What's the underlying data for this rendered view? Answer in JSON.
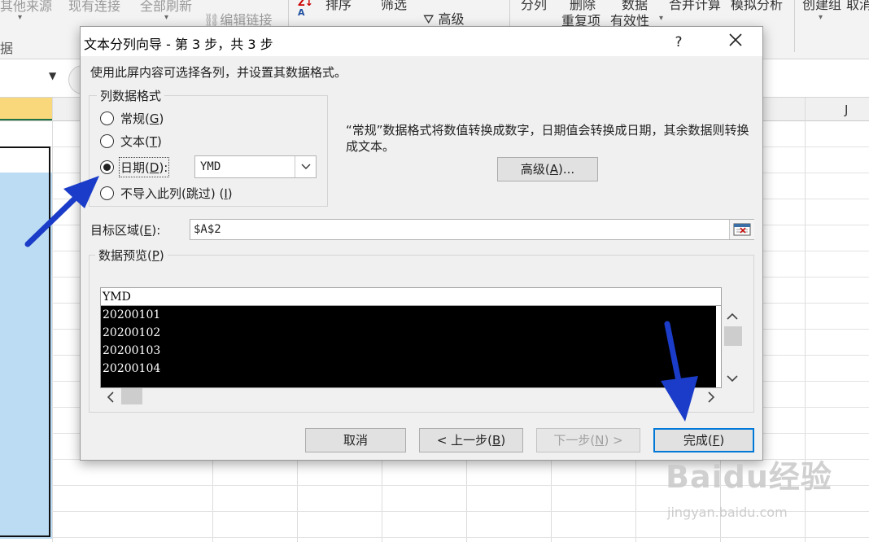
{
  "ribbon": {
    "items": [
      {
        "label": "其他来源"
      },
      {
        "label": "现有连接"
      },
      {
        "label": "全部刷新"
      },
      {
        "label": "编辑链接"
      },
      {
        "label": "排序"
      },
      {
        "label": "筛选"
      },
      {
        "label": "高级"
      },
      {
        "label": "分列"
      },
      {
        "label": "删除"
      },
      {
        "label": "数据"
      },
      {
        "label": "合并计算"
      },
      {
        "label": "模拟分析"
      },
      {
        "label": "创建组"
      },
      {
        "label": "取消"
      },
      {
        "label": "重复项"
      },
      {
        "label": "有效性"
      }
    ],
    "group_label": "据"
  },
  "sheet": {
    "column_j": "J",
    "accent_color": "#217346",
    "selection_color": "#bcdcf4"
  },
  "dialog": {
    "title": "文本分列向导 - 第 3 步，共 3 步",
    "help": "?",
    "close": "✕",
    "instructions": "使用此屏内容可选择各列，并设置其数据格式。",
    "format_group": {
      "legend": "列数据格式",
      "options": [
        {
          "label": "常规",
          "key": "G",
          "checked": false
        },
        {
          "label": "文本",
          "key": "T",
          "checked": false
        },
        {
          "label": "日期",
          "key": "D",
          "checked": true
        },
        {
          "label": "不导入此列(跳过)",
          "key": "I",
          "checked": false
        }
      ],
      "date_format": "YMD"
    },
    "description": "“常规”数据格式将数值转换成数字，日期值会转换成日期，其余数据则转换成文本。",
    "advanced_label": "高级",
    "advanced_key": "A",
    "target": {
      "label": "目标区域",
      "key": "E",
      "value": "$A$2"
    },
    "preview": {
      "legend": "数据预览",
      "key": "P",
      "header": "YMD",
      "rows": [
        "20200101",
        "20200102",
        "20200103",
        "20200104"
      ]
    },
    "buttons": {
      "cancel": "取消",
      "back": "< 上一步",
      "back_key": "B",
      "next": "下一步",
      "next_key": "N",
      "finish": "完成",
      "finish_key": "F"
    }
  },
  "annotations": {
    "arrow_color": "#1a3cc8"
  },
  "watermark": {
    "text": "Baidu经验",
    "sub": "jingyan.baidu.com"
  }
}
